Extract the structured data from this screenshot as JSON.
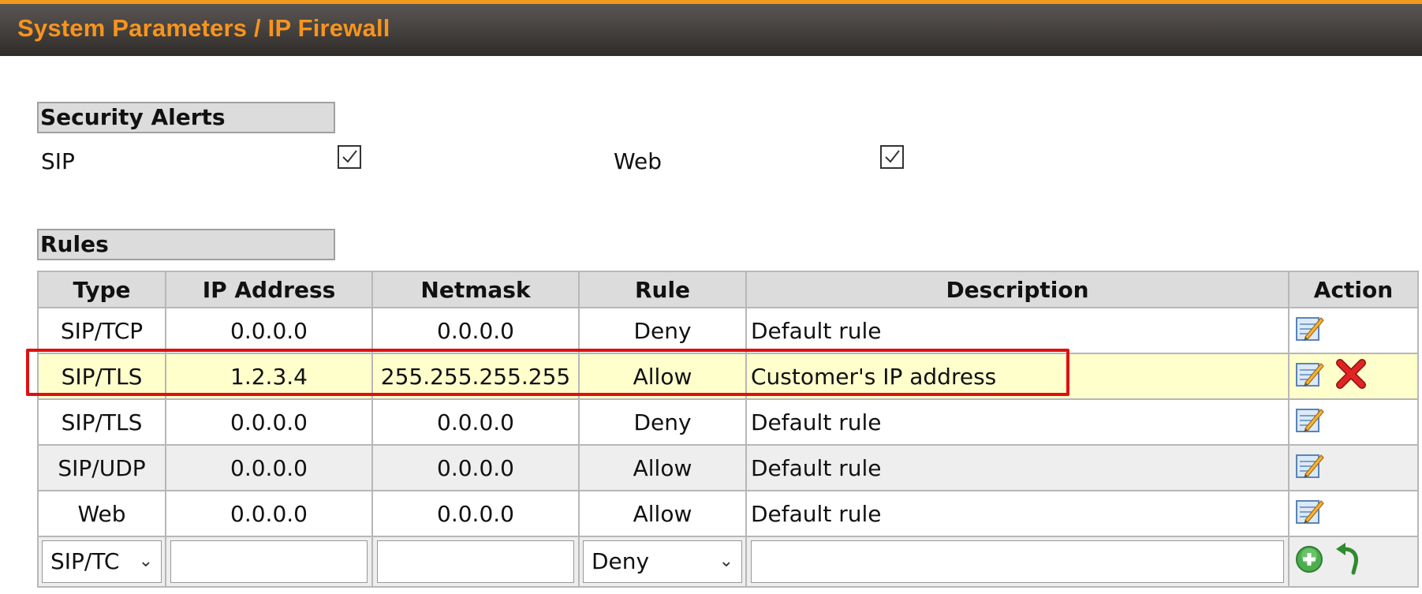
{
  "header": {
    "title": "System Parameters / IP Firewall"
  },
  "security_alerts": {
    "title": "Security Alerts",
    "items": [
      {
        "label": "SIP",
        "checked": true
      },
      {
        "label": "Web",
        "checked": true
      }
    ]
  },
  "rules": {
    "title": "Rules",
    "columns": [
      "Type",
      "IP Address",
      "Netmask",
      "Rule",
      "Description",
      "Action"
    ],
    "rows": [
      {
        "type": "SIP/TCP",
        "ip": "0.0.0.0",
        "netmask": "0.0.0.0",
        "rule": "Deny",
        "description": "Default rule",
        "actions": [
          "edit-icon"
        ]
      },
      {
        "type": "SIP/TLS",
        "ip": "1.2.3.4",
        "netmask": "255.255.255.255",
        "rule": "Allow",
        "description": "Customer's IP address",
        "actions": [
          "edit-icon",
          "delete-icon"
        ]
      },
      {
        "type": "SIP/TLS",
        "ip": "0.0.0.0",
        "netmask": "0.0.0.0",
        "rule": "Deny",
        "description": "Default rule",
        "actions": [
          "edit-icon"
        ]
      },
      {
        "type": "SIP/UDP",
        "ip": "0.0.0.0",
        "netmask": "0.0.0.0",
        "rule": "Allow",
        "description": "Default rule",
        "actions": [
          "edit-icon"
        ]
      },
      {
        "type": "Web",
        "ip": "0.0.0.0",
        "netmask": "0.0.0.0",
        "rule": "Allow",
        "description": "Default rule",
        "actions": [
          "edit-icon"
        ]
      }
    ],
    "new_rule": {
      "type_value": "SIP/TC",
      "ip_value": "",
      "netmask_value": "",
      "rule_value": "Deny",
      "description_value": "",
      "actions": [
        "add-icon",
        "undo-icon"
      ]
    }
  },
  "colors": {
    "header_accent": "#f7941d",
    "highlight_row": "#ffffcc",
    "highlight_border": "#e01010",
    "delete": "#d81e1e"
  }
}
